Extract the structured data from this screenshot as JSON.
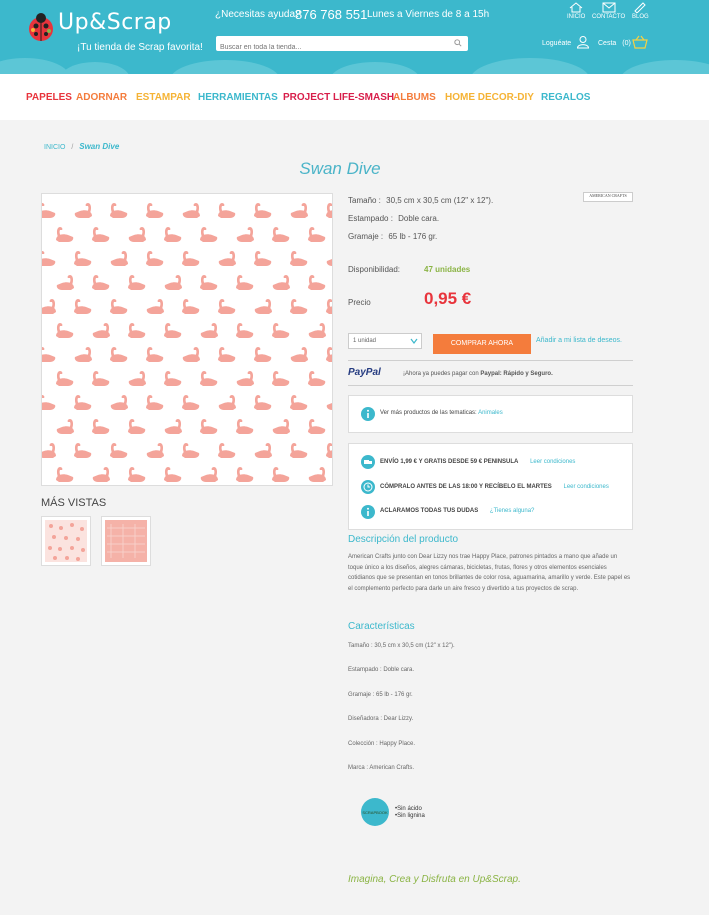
{
  "header": {
    "logo_text": "Up&Scrap",
    "tagline": "¡Tu tienda de Scrap favorita!",
    "help_label": "¿Necesitas ayuda?",
    "phone": "876 768 551",
    "hours": "Lunes a Viernes de 8 a 15h",
    "search_placeholder": "Buscar en toda la tienda...",
    "top_links": [
      "INICIO",
      "CONTACTO",
      "BLOG"
    ],
    "login_label": "Loguéate",
    "cart_label": "Cesta",
    "cart_count": "(0)"
  },
  "nav": {
    "items": [
      {
        "label": "PAPELES",
        "color": "#e8343c"
      },
      {
        "label": "ADORNAR",
        "color": "#f47c3c"
      },
      {
        "label": "ESTAMPAR",
        "color": "#f5b335"
      },
      {
        "label": "HERRAMIENTAS",
        "color": "#3cb8cc"
      },
      {
        "label": "PROJECT LIFE-SMASH",
        "color": "#d81e4a"
      },
      {
        "label": "ALBUMS",
        "color": "#f47c3c"
      },
      {
        "label": "HOME DECOR-DIY",
        "color": "#f5b335"
      },
      {
        "label": "REGALOS",
        "color": "#3cb8cc"
      }
    ]
  },
  "breadcrumb": {
    "home": "INICIO",
    "separator": "/",
    "current": "Swan Dive"
  },
  "product": {
    "title": "Swan Dive",
    "brand_logo": "AMERICAN CRAFTS",
    "specs": [
      {
        "label": "Tamaño :",
        "value": "30,5 cm x 30,5 cm (12\" x 12\")."
      },
      {
        "label": "Estampado :",
        "value": "Doble cara."
      },
      {
        "label": "Gramaje :",
        "value": "65 lb - 176 gr."
      }
    ],
    "availability_label": "Disponibilidad:",
    "availability_value": "47 unidades",
    "price_label": "Precio",
    "price": "0,95 €",
    "qty_selected": "1 unidad",
    "buy_label": "COMPRAR AHORA",
    "wishlist_label": "Añadir a mi lista de deseos.",
    "paypal_brand": "PayPal",
    "paypal_text_1": "¡Ahora ya puedes pagar con",
    "paypal_text_2": "Paypal: Rápido y Seguro.",
    "themes_text": "Ver más productos de las tematicas:",
    "themes_link": "Animales",
    "more_views": "MÁS VISTAS",
    "shipping": {
      "text": "ENVÍO 1,99 € Y GRATIS DESDE 59 € PENINSULA",
      "link": "Leer condiciones"
    },
    "cutoff": {
      "text": "CÓMPRALO ANTES DE LAS 18:00 Y RECÍBELO EL MARTES",
      "link": "Leer condiciones"
    },
    "doubts": {
      "text": "ACLARAMOS TODAS TUS DUDAS",
      "link": "¿Tienes alguna?"
    },
    "description_heading": "Descripción del producto",
    "description": "American Crafts junto con Dear Lizzy nos trae Happy Place, patrones pintados a mano que añade un toque único a los diseños, alegres cámaras, bicicletas, frutas, flores y otros elementos esenciales cotidianos que se presentan en tonos brillantes de color rosa, aguamarina, amarillo y verde. Este papel es el complemento perfecto para darle un aire fresco y divertido a tus proyectos de scrap.",
    "characteristics_heading": "Características",
    "characteristics": [
      "Tamaño :   30,5 cm x 30,5 cm (12\" x 12\").",
      "Estampado :   Doble cara.",
      "Gramaje :   65 lb - 176 gr.",
      "Diseñadora :   Dear Lizzy.",
      "Colección :   Happy Place.",
      "Marca :   American Crafts."
    ],
    "acid_badge": "SCRAPBOOK",
    "acid_lines": [
      "•Sin ácido",
      "•Sin lignina"
    ],
    "footer_tagline": "Imagina, Crea y Disfruta en Up&Scrap.",
    "swan_color": "#f4a49a"
  }
}
